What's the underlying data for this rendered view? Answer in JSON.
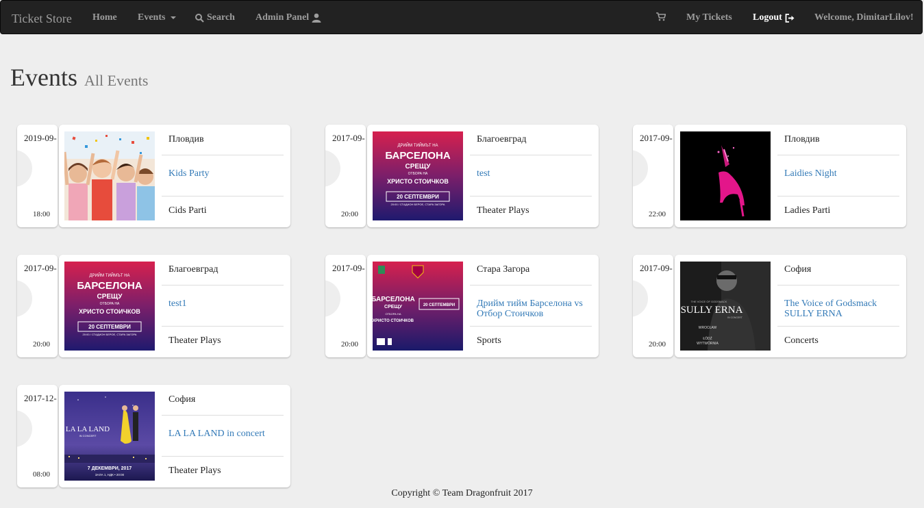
{
  "navbar": {
    "brand": "Ticket Store",
    "home": "Home",
    "events": "Events",
    "search": "Search",
    "admin": "Admin Panel",
    "my_tickets": "My Tickets",
    "logout": "Logout",
    "welcome": "Welcome, DimitarLilov!"
  },
  "header": {
    "title": "Events",
    "subtitle": "All Events"
  },
  "events": [
    {
      "date": "2019-09-",
      "time": "18:00",
      "city": "Пловдив",
      "name": "Kids Party",
      "category": "Cids Parti",
      "poster": "kids"
    },
    {
      "date": "2017-09-",
      "time": "20:00",
      "city": "Благоевград",
      "name": "test",
      "category": "Theater Plays",
      "poster": "barca"
    },
    {
      "date": "2017-09-",
      "time": "22:00",
      "city": "Пловдив",
      "name": "Laidies Night",
      "category": "Ladies Parti",
      "poster": "shoe"
    },
    {
      "date": "2017-09-",
      "time": "20:00",
      "city": "Благоевград",
      "name": "test1",
      "category": "Theater Plays",
      "poster": "barca"
    },
    {
      "date": "2017-09-",
      "time": "20:00",
      "city": "Стара Загора",
      "name": "Дрийм тийм Барселона vs Отбор Стоичков",
      "category": "Sports",
      "poster": "barca2"
    },
    {
      "date": "2017-09-",
      "time": "20:00",
      "city": "София",
      "name": "The Voice of Godsmack SULLY ERNA",
      "category": "Concerts",
      "poster": "sully"
    },
    {
      "date": "2017-12-",
      "time": "08:00",
      "city": "София",
      "name": "LA LA LAND in concert",
      "category": "Theater Plays",
      "poster": "lalaland"
    }
  ],
  "posters": {
    "barca": {
      "top": "ДРИЙМ ТИЙМЪТ НА",
      "big": "БАРСЕЛОНА",
      "mid": "СРЕЩУ",
      "sub": "ОТБОРА НА",
      "name": "ХРИСТО СТОИЧКОВ",
      "date": "20 СЕПТЕМВРИ",
      "place": "20:00 / СТАДИОН БЕРОЕ, СТАРА ЗАГОРА"
    },
    "barca2": {
      "big": "БАРСЕЛОНА",
      "mid": "СРЕЩУ",
      "sub": "ОТБОРА НА",
      "name": "ХРИСТО СТОИЧКОВ",
      "date": "20 СЕПТЕМВРИ"
    },
    "sully": {
      "top": "THE VOICE OF GODSMACK",
      "big": "SULLY ERNA",
      "mid": "IN CONCERT",
      "city1": "WROCŁAW",
      "city2": "ŁÓDŹ",
      "venue": "WYTWÓRNIA"
    },
    "lalaland": {
      "big": "LA LA LAND",
      "mid": "IN CONCERT",
      "date": "7 ДЕКЕМВРИ, 2017",
      "place": "ЗАЛА 1, НДК • 20:00"
    }
  },
  "footer": "Copyright © Team Dragonfruit 2017",
  "colors": {
    "navbar": "#222222",
    "link": "#337ab7",
    "background": "#eeeeee"
  }
}
